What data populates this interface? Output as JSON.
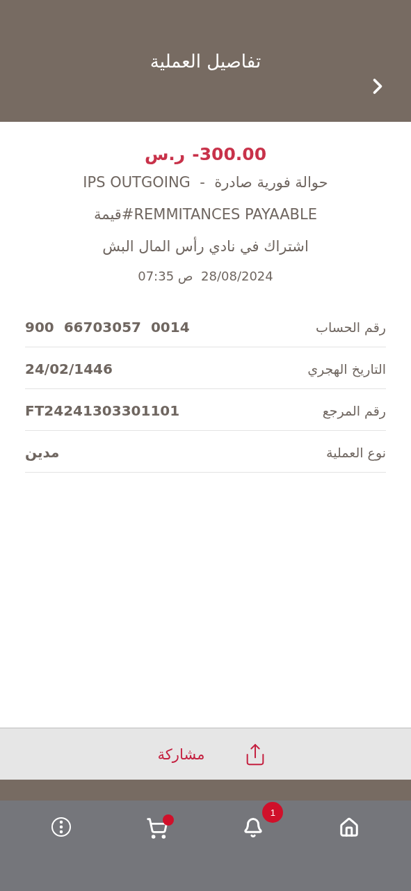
{
  "header": {
    "title": "تفاصيل العملية"
  },
  "summary": {
    "currency": "ر.س",
    "amount": "-300.00",
    "lines": [
      "حوالة فورية صادرة  -  IPS OUTGOING",
      "قيمة#REMMITANCES PAYAABLE",
      "اشتراك في نادي رأس المال البش"
    ],
    "datetime": "28/08/2024  ص 07:35"
  },
  "details": [
    {
      "label": "رقم الحساب",
      "value": "900  66703057  0014"
    },
    {
      "label": "التاريخ الهجري",
      "value": "24/02/1446"
    },
    {
      "label": "رقم المرجع",
      "value": "FT24241303301101"
    },
    {
      "label": "نوع العملية",
      "value": "مدين"
    }
  ],
  "share_button": {
    "label": "مشاركة"
  },
  "bottom_nav": [
    {
      "kind": "more"
    },
    {
      "kind": "cart",
      "dot": true
    },
    {
      "kind": "bell",
      "badge": "1"
    },
    {
      "kind": "home"
    }
  ]
}
